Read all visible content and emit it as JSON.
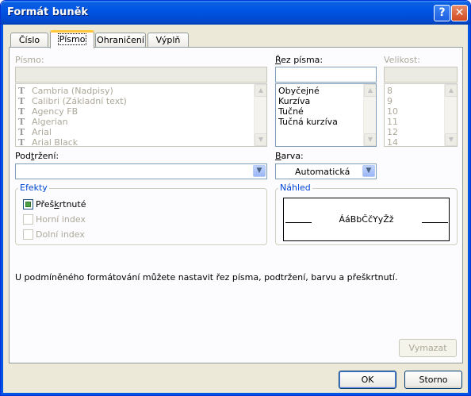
{
  "window": {
    "title": "Formát buněk"
  },
  "title_buttons": {
    "help": "?",
    "close": "✕"
  },
  "tabs": [
    {
      "label": "Číslo",
      "active": false
    },
    {
      "label": "Písmo",
      "active": true
    },
    {
      "label": "Ohraničení",
      "active": false
    },
    {
      "label": "Výplň",
      "active": false
    }
  ],
  "font": {
    "label": "Písmo:",
    "value": "",
    "items": [
      "Cambria (Nadpisy)",
      "Calibri (Základní text)",
      "Agency FB",
      "Algerian",
      "Arial",
      "Arial Black"
    ]
  },
  "style": {
    "label": "Řez písma:",
    "value": "",
    "items": [
      "Obyčejné",
      "Kurzíva",
      "Tučné",
      "Tučná kurzíva"
    ]
  },
  "size": {
    "label": "Velikost:",
    "value": "",
    "items": [
      "8",
      "9",
      "10",
      "11",
      "12",
      "14"
    ]
  },
  "underline": {
    "label": "Podtržení:",
    "value": ""
  },
  "color": {
    "label": "Barva:",
    "value": "Automatická"
  },
  "effects": {
    "title": "Efekty",
    "strikethrough": {
      "label": "Přeškrtnuté",
      "state": "indeterminate"
    },
    "superscript": {
      "label": "Horní index",
      "checked": false
    },
    "subscript": {
      "label": "Dolní index",
      "checked": false
    }
  },
  "preview": {
    "title": "Náhled",
    "sample": "ÁáBbČčYyŽž"
  },
  "info_text": "U podmíněného formátování můžete nastavit řez písma, podtržení, barvu a přeškrtnutí.",
  "buttons": {
    "clear": "Vymazat",
    "ok": "OK",
    "cancel": "Storno"
  },
  "icons": {
    "font_item": "truetype-font-icon",
    "scroll_up": "▲",
    "scroll_down": "▼",
    "dropdown": "▼"
  }
}
